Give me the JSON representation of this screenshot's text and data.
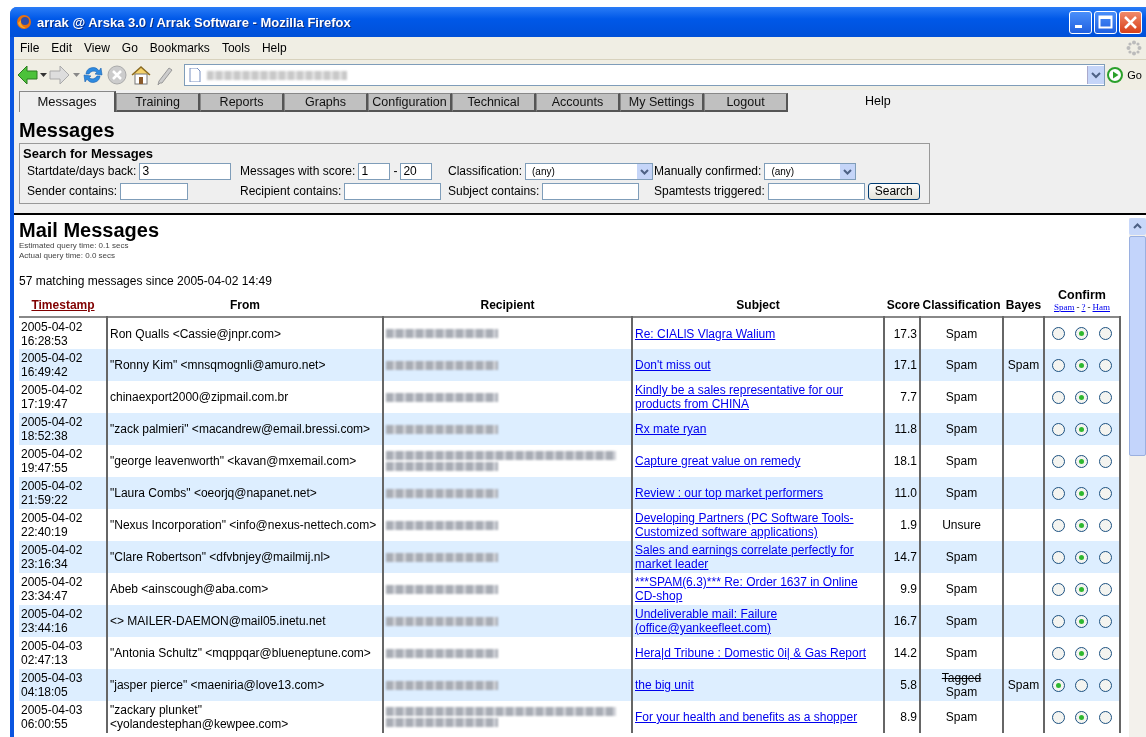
{
  "window": {
    "title": "arrak @ Arska 3.0 / Arrak Software - Mozilla Firefox"
  },
  "menu": [
    "File",
    "Edit",
    "View",
    "Go",
    "Bookmarks",
    "Tools",
    "Help"
  ],
  "address_bar": {
    "go_label": "Go"
  },
  "tabs": [
    {
      "label": "Messages",
      "selected": true
    },
    {
      "label": "Training",
      "selected": false
    },
    {
      "label": "Reports",
      "selected": false
    },
    {
      "label": "Graphs",
      "selected": false
    },
    {
      "label": "Configuration",
      "selected": false
    },
    {
      "label": "Technical",
      "selected": false
    },
    {
      "label": "Accounts",
      "selected": false
    },
    {
      "label": "My Settings",
      "selected": false
    },
    {
      "label": "Logout",
      "selected": false
    }
  ],
  "help_link": "Help",
  "page_title": "Messages",
  "search": {
    "title": "Search for Messages",
    "button": "Search",
    "rows": [
      [
        {
          "kind": "text",
          "label": "Startdate/days back:",
          "value": "3"
        },
        {
          "kind": "range",
          "label": "Messages with score:",
          "from": "1",
          "separator": "-",
          "to": "20"
        },
        {
          "kind": "select",
          "label": "Classification:",
          "value": "(any)"
        },
        {
          "kind": "select",
          "label": "Manually confirmed:",
          "value": "(any)"
        }
      ],
      [
        {
          "kind": "text",
          "label": "Sender contains:"
        },
        {
          "kind": "text",
          "label": "Recipient contains:"
        },
        {
          "kind": "text",
          "label": "Subject contains:"
        },
        {
          "kind": "text",
          "label": "Spamtests triggered:"
        }
      ]
    ]
  },
  "results": {
    "title": "Mail Messages",
    "query_times": [
      "Estimated query time: 0.1 secs",
      "Actual query time: 0.0 secs"
    ],
    "summary": "57 matching messages since 2005-04-02 14:49"
  },
  "table": {
    "columns": [
      "Timestamp",
      "From",
      "Recipient",
      "Subject",
      "Score",
      "Classification",
      "Bayes",
      "Confirm"
    ],
    "confirm_links": [
      "Spam",
      "?",
      "Ham"
    ],
    "confirm_link_separator": "-",
    "rows": [
      {
        "timestamp": [
          "2005-04-02",
          "16:28:53"
        ],
        "from": "Ron Qualls <Cassie@jnpr.com>",
        "recipient_multiline": false,
        "subject": "Re: CIALlS Vlagra Walium",
        "score": "17.3",
        "classification": "Spam",
        "confirm": [
          {
            "selected": false
          },
          {
            "selected": true
          },
          {
            "selected": false
          }
        ]
      },
      {
        "timestamp": [
          "2005-04-02",
          "16:49:42"
        ],
        "from": "\"Ronny Kim\" <mnsqmognli@amuro.net>",
        "recipient_multiline": false,
        "subject": "Don't miss out",
        "score": "17.1",
        "classification": "Spam",
        "bayes": "Spam",
        "confirm": [
          {
            "selected": false
          },
          {
            "selected": true
          },
          {
            "selected": false
          }
        ]
      },
      {
        "timestamp": [
          "2005-04-02",
          "17:19:47"
        ],
        "from": "chinaexport2000@zipmail.com.br",
        "recipient_multiline": false,
        "subject": "Kindly be a sales representative for our products from CHINA",
        "score": "7.7",
        "classification": "Spam",
        "confirm": [
          {
            "selected": false
          },
          {
            "selected": true
          },
          {
            "selected": false
          }
        ]
      },
      {
        "timestamp": [
          "2005-04-02",
          "18:52:38"
        ],
        "from": "\"zack palmieri\" <macandrew@email.bressi.com>",
        "recipient_multiline": false,
        "subject": "Rx mate ryan",
        "score": "11.8",
        "classification": "Spam",
        "confirm": [
          {
            "selected": false
          },
          {
            "selected": true
          },
          {
            "selected": false
          }
        ]
      },
      {
        "timestamp": [
          "2005-04-02",
          "19:47:55"
        ],
        "from": "\"george leavenworth\" <kavan@mxemail.com>",
        "recipient_multiline": true,
        "subject": "Capture great value on remedy",
        "score": "18.1",
        "classification": "Spam",
        "confirm": [
          {
            "selected": false
          },
          {
            "selected": true
          },
          {
            "selected": false
          }
        ]
      },
      {
        "timestamp": [
          "2005-04-02",
          "21:59:22"
        ],
        "from": "\"Laura Combs\" <oeorjq@napanet.net>",
        "recipient_multiline": false,
        "subject": "Review : our top market performers",
        "score": "11.0",
        "classification": "Spam",
        "confirm": [
          {
            "selected": false
          },
          {
            "selected": true
          },
          {
            "selected": false
          }
        ]
      },
      {
        "timestamp": [
          "2005-04-02",
          "22:40:19"
        ],
        "from": "\"Nexus Incorporation\" <info@nexus-nettech.com>",
        "recipient_multiline": false,
        "subject": "Developing Partners (PC Software Tools-Customized software applications)",
        "score": "1.9",
        "classification": "Unsure",
        "confirm": [
          {
            "selected": false
          },
          {
            "selected": true
          },
          {
            "selected": false
          }
        ]
      },
      {
        "timestamp": [
          "2005-04-02",
          "23:16:34"
        ],
        "from": "\"Clare Robertson\" <dfvbnjey@mailmij.nl>",
        "recipient_multiline": false,
        "subject": "Sales and earnings correlate perfectly for market leader",
        "score": "14.7",
        "classification": "Spam",
        "confirm": [
          {
            "selected": false
          },
          {
            "selected": true
          },
          {
            "selected": false
          }
        ]
      },
      {
        "timestamp": [
          "2005-04-02",
          "23:34:47"
        ],
        "from": "Abeb <ainscough@aba.com>",
        "recipient_multiline": false,
        "subject": "***SPAM(6.3)*** Re: Order 1637 in Online CD-shop",
        "score": "9.9",
        "classification": "Spam",
        "confirm": [
          {
            "selected": false
          },
          {
            "selected": true
          },
          {
            "selected": false
          }
        ]
      },
      {
        "timestamp": [
          "2005-04-02",
          "23:44:16"
        ],
        "from": "<> MAILER-DAEMON@mail05.inetu.net",
        "recipient_multiline": false,
        "subject": "Undeliverable mail: Failure (office@yankeefleet.com)",
        "score": "16.7",
        "classification": "Spam",
        "confirm": [
          {
            "selected": false
          },
          {
            "selected": true
          },
          {
            "selected": false
          }
        ]
      },
      {
        "timestamp": [
          "2005-04-03",
          "02:47:13"
        ],
        "from": "\"Antonia Schultz\" <mqppqar@blueneptune.com>",
        "recipient_multiline": false,
        "subject": "Hera|d Tribune : Domestic 0i| & Gas Report",
        "score": "14.2",
        "classification": "Spam",
        "confirm": [
          {
            "selected": false
          },
          {
            "selected": true
          },
          {
            "selected": false
          }
        ]
      },
      {
        "timestamp": [
          "2005-04-03",
          "04:18:05"
        ],
        "from": "\"jasper pierce\" <maeniria@love13.com>",
        "recipient_multiline": false,
        "subject": "the big unit",
        "score": "5.8",
        "classification_struck": "Tagged",
        "classification": "Spam",
        "bayes": "Spam",
        "confirm": [
          {
            "selected": true
          },
          {
            "selected": false
          },
          {
            "selected": false
          }
        ]
      },
      {
        "timestamp": [
          "2005-04-03",
          "06:00:55"
        ],
        "from": "\"zackary plunket\" <yolandestephan@kewpee.com>",
        "recipient_multiline": true,
        "subject": "For your health and benefits as a shopper",
        "score": "8.9",
        "classification": "Spam",
        "confirm": [
          {
            "selected": false
          },
          {
            "selected": true
          },
          {
            "selected": false
          }
        ]
      }
    ]
  }
}
